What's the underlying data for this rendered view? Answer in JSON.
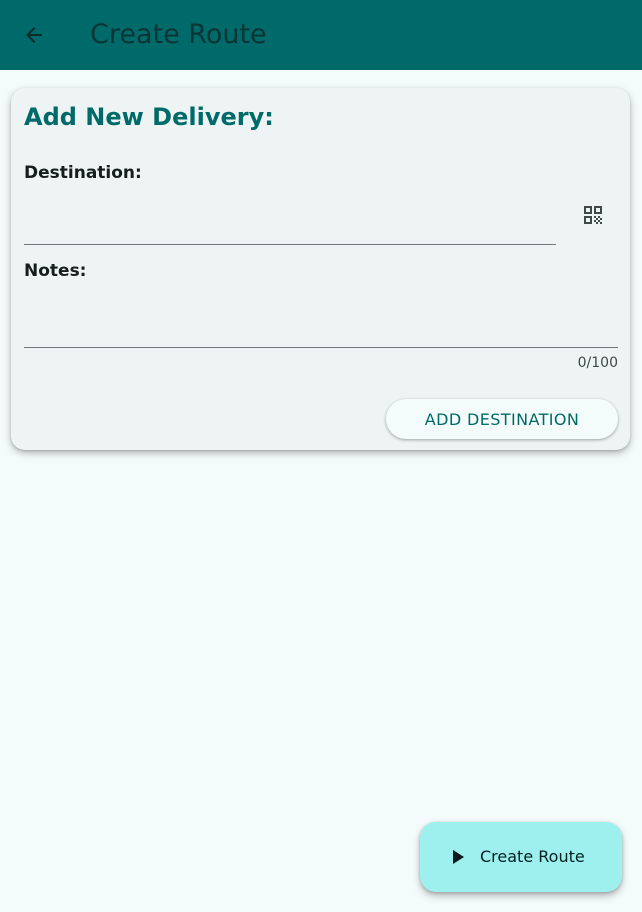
{
  "appbar": {
    "back_icon": "arrow-back-icon",
    "title": "Create Route",
    "background": "#006a6a"
  },
  "card": {
    "title": "Add New Delivery:",
    "destination": {
      "label": "Destination:",
      "value": "",
      "scan_icon": "qr-code-icon"
    },
    "notes": {
      "label": "Notes:",
      "value": "",
      "counter": "0/100"
    },
    "add_button_label": "ADD DESTINATION"
  },
  "fab": {
    "icon": "play-icon",
    "label": "Create Route",
    "background": "#9ef0ef"
  }
}
